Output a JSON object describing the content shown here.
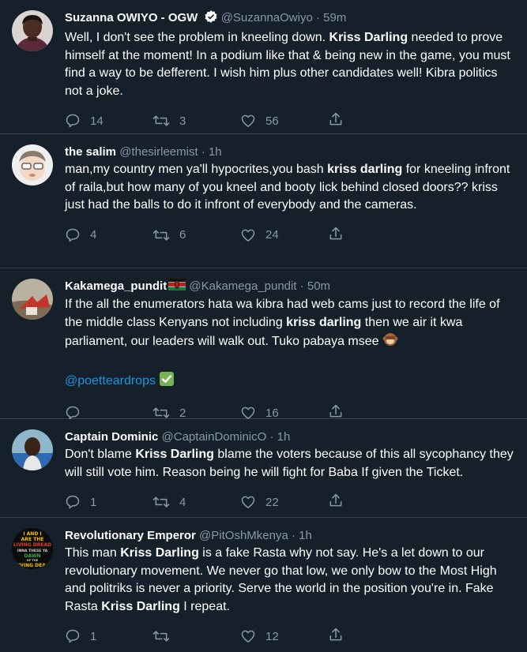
{
  "tweets": [
    {
      "name": "Suzanna OWIYO - OGW",
      "handle": "@SuzannaOwiyo",
      "sep": "·",
      "time": "59m",
      "text": [
        "Well, I don't see the problem in kneeling down. ",
        "Kriss Darling",
        " needed to prove himself at the moment! In a podium like that & being new in the game, you must find a way to be defferent. I wish him plus other candidates well! Kibra politics not a joke."
      ],
      "replies": "14",
      "retweets": "3",
      "likes": "56"
    },
    {
      "name": "the salim",
      "handle": "@thesirleemist",
      "sep": "·",
      "time": "1h",
      "text": [
        "man,my country men ya'll hypocrites,you bash ",
        "kriss darling",
        " for kneeling infront of raila,but how many of you kneel and booty lick behind closed doors?? kriss just had the balls to do it infront of everybody and the cameras."
      ],
      "replies": "4",
      "retweets": "6",
      "likes": "24"
    },
    {
      "name": "Kakamega_pundit",
      "handle": "@Kakamega_pundit",
      "sep": "·",
      "time": "50m",
      "text": [
        "If the all the enumerators hata wa kibra had web cams just to record the life of the middle class Kenyans not including ",
        "kriss darling",
        " then we air it kwa parliament, our leaders will walk out. Tuko pabaya msee "
      ],
      "mention": "@poetteardrops",
      "replies": "",
      "retweets": "2",
      "likes": "16"
    },
    {
      "name": "Captain Dominic",
      "handle": "@CaptainDominicO",
      "sep": "·",
      "time": "1h",
      "text": [
        "Don't blame ",
        "Kriss Darling",
        " blame the voters because of this all sycophancy they will still vote him. Reason being he will fight for Baba If given the Ticket."
      ],
      "replies": "1",
      "retweets": "4",
      "likes": "22"
    },
    {
      "name": "Revolutionary Emperor",
      "handle": "@PitOshMkenya",
      "sep": "·",
      "time": "1h",
      "text": [
        "This man ",
        "Kriss Darling",
        " is a fake Rasta why not say. He's a let down to our revolutionary movement. We never go that low, we only bow to the Most High and politriks is never a priority. Serve the world in the position you're in. Fake Rasta ",
        "Kriss Darling",
        " I repeat."
      ],
      "avatar_text": [
        "I AND I",
        "ARE THE",
        "LIVING DREAD",
        "INNA THESE YA",
        "DAWN",
        "OF THE",
        "LIVING DEAD"
      ],
      "replies": "1",
      "retweets": "",
      "likes": "12"
    }
  ]
}
